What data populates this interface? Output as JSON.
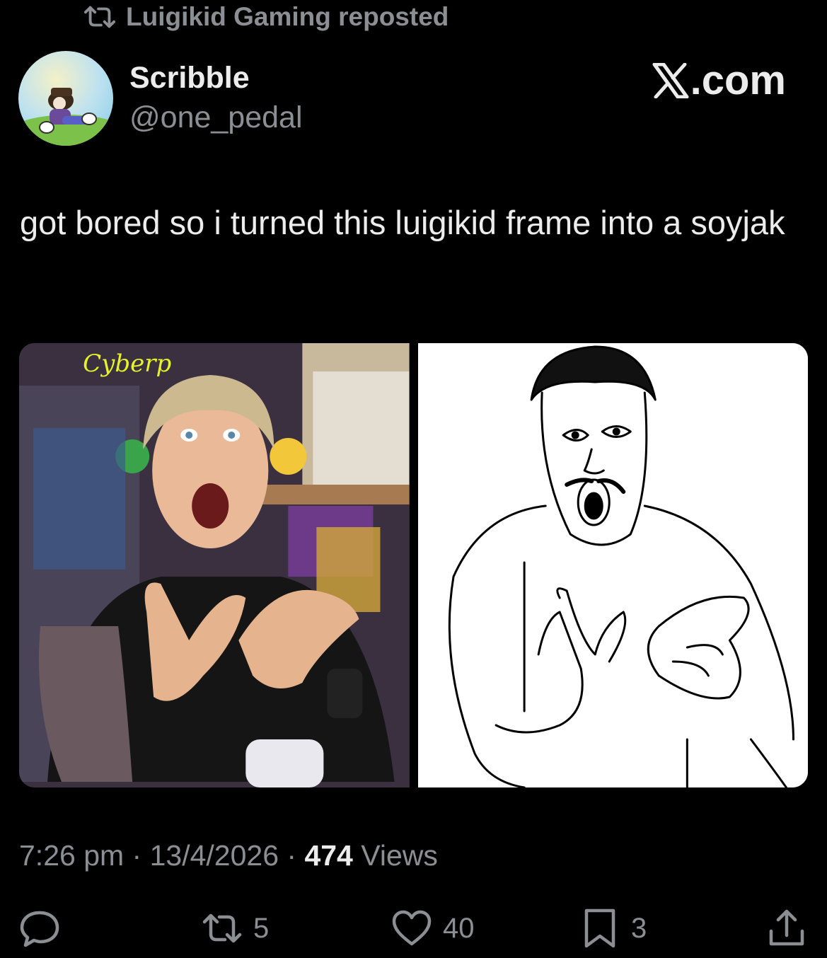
{
  "repost": {
    "icon": "repost-icon",
    "text": "Luigikid Gaming reposted"
  },
  "author": {
    "display_name": "Scribble",
    "handle": "@one_pedal",
    "avatar_icon": "avatar-image"
  },
  "brand": {
    "logo_icon": "x-logo-icon",
    "suffix": ".com"
  },
  "tweet": {
    "text": "got bored so i turned this luigikid frame into a soyjak"
  },
  "media": [
    {
      "name": "photo-frame"
    },
    {
      "name": "soyjak-drawing"
    }
  ],
  "meta": {
    "time": "7:26 pm",
    "sep1": " · ",
    "date": "13/4/2026",
    "sep2": " · ",
    "views_count": "474",
    "views_label": " Views"
  },
  "actions": {
    "reply": {
      "icon": "reply-icon",
      "count": ""
    },
    "repost": {
      "icon": "repost-icon",
      "count": "5"
    },
    "like": {
      "icon": "heart-icon",
      "count": "40"
    },
    "bookmark": {
      "icon": "bookmark-icon",
      "count": "3"
    },
    "share": {
      "icon": "share-icon",
      "count": ""
    }
  },
  "colors": {
    "background": "#000000",
    "primary_text": "#ececec",
    "secondary_text": "#8b8f94"
  }
}
